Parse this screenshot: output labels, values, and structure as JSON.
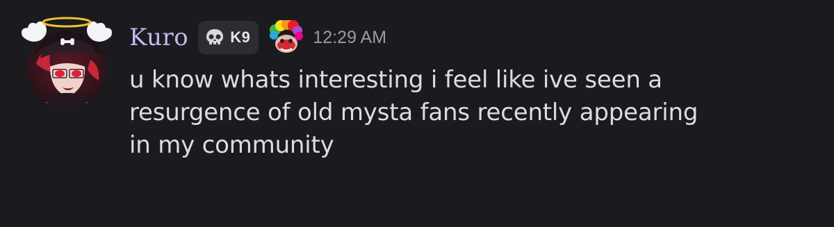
{
  "message": {
    "author": {
      "username": "Kuro",
      "avatar_icon": "anime-avatar-with-halo-and-wings",
      "name_color": "#c6b9f3"
    },
    "tag": {
      "icon": "skull-icon",
      "label": "K9"
    },
    "decoration_icon": "rainbow-clown-icon",
    "timestamp": "12:29 AM",
    "content_lines": [
      "u know whats interesting i feel like ive seen a",
      "resurgence of old mysta fans recently appearing",
      "in my community"
    ]
  },
  "theme": {
    "background": "#1b1b1f",
    "text": "#dbdee1",
    "muted": "#9b9ba3",
    "badge_bg": "#2c2c33"
  }
}
